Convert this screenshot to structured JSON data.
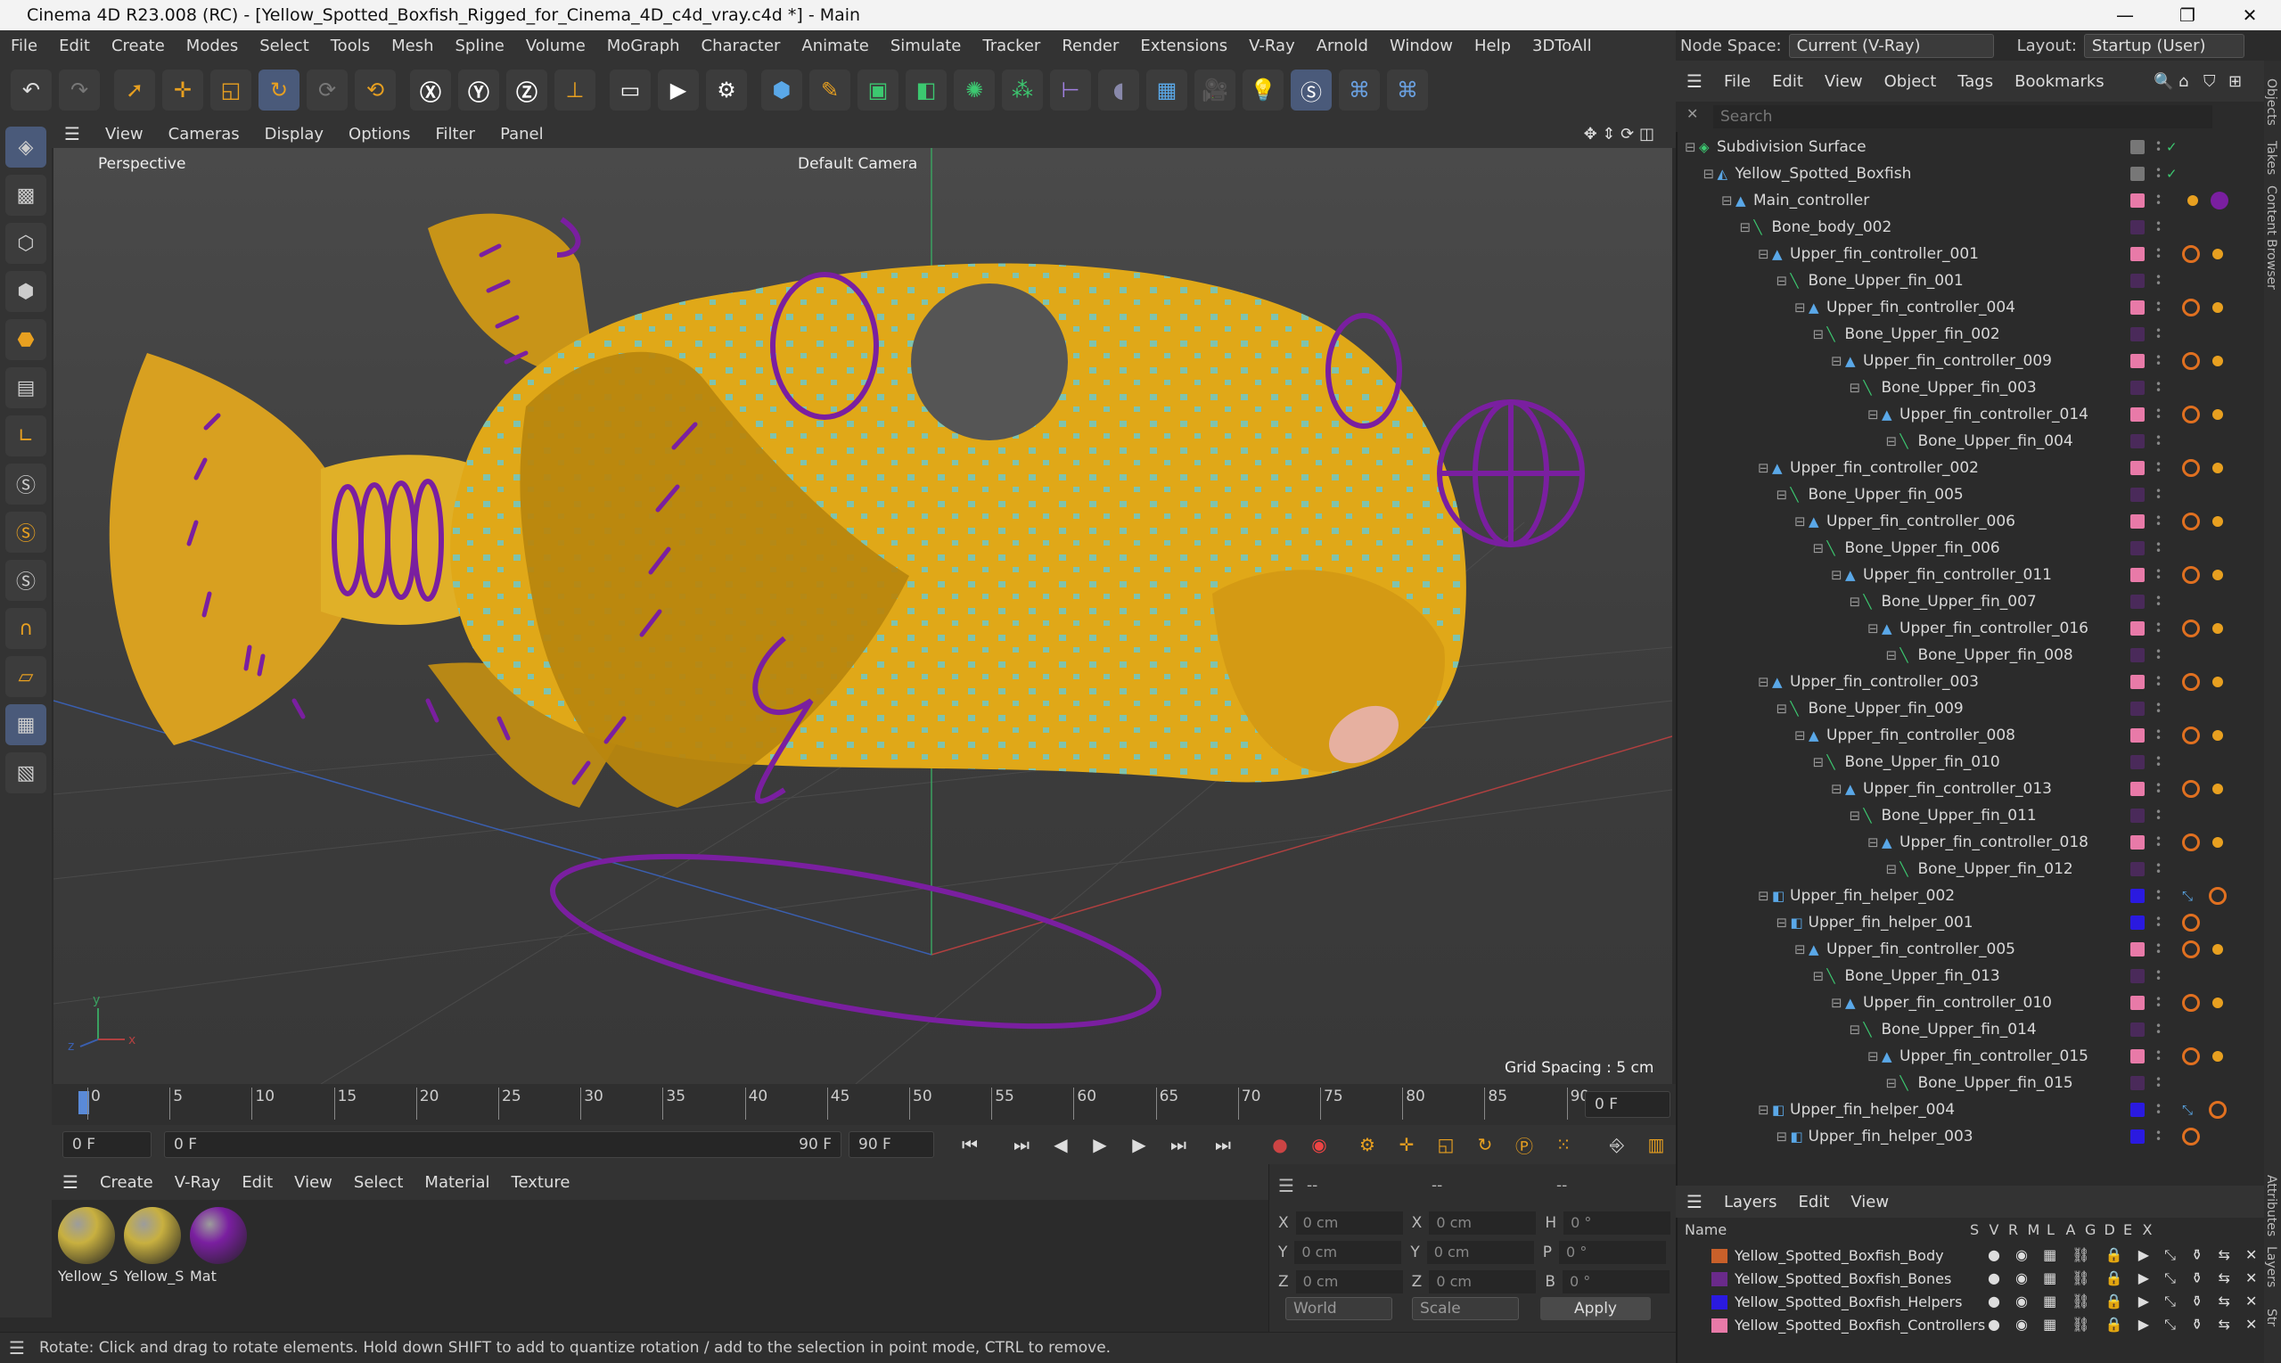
{
  "title": "Cinema 4D R23.008 (RC) - [Yellow_Spotted_Boxfish_Rigged_for_Cinema_4D_c4d_vray.c4d *] - Main",
  "menu": [
    "File",
    "Edit",
    "Create",
    "Modes",
    "Select",
    "Tools",
    "Mesh",
    "Spline",
    "Volume",
    "MoGraph",
    "Character",
    "Animate",
    "Simulate",
    "Tracker",
    "Render",
    "Extensions",
    "V-Ray",
    "Arnold",
    "Window",
    "Help",
    "3DToAll"
  ],
  "node_space": {
    "label": "Node Space:",
    "value": "Current (V-Ray)"
  },
  "layout": {
    "label": "Layout:",
    "value": "Startup (User)"
  },
  "viewport": {
    "menu": [
      "View",
      "Cameras",
      "Display",
      "Options",
      "Filter",
      "Panel"
    ],
    "mode": "Perspective",
    "camera": "Default Camera",
    "grid_spacing": "Grid Spacing : 5 cm"
  },
  "timeline": {
    "ticks": [
      "0",
      "5",
      "10",
      "15",
      "20",
      "25",
      "30",
      "35",
      "40",
      "45",
      "50",
      "55",
      "60",
      "65",
      "70",
      "75",
      "80",
      "85",
      "90"
    ],
    "current_frame": "0 F",
    "start": "0 F",
    "range_start": "0 F",
    "range_end": "90 F",
    "end": "90 F"
  },
  "material_manager": {
    "menu": [
      "Create",
      "V-Ray",
      "Edit",
      "View",
      "Select",
      "Material",
      "Texture"
    ],
    "materials": [
      {
        "label": "Yellow_S",
        "color": "#c8b040"
      },
      {
        "label": "Yellow_S",
        "color": "#c8b040"
      },
      {
        "label": "Mat",
        "color": "#7a1fa0"
      }
    ]
  },
  "coordinates": {
    "header": [
      "--",
      "--",
      "--"
    ],
    "rows": [
      {
        "a": "X",
        "av": "0 cm",
        "b": "X",
        "bv": "0 cm",
        "c": "H",
        "cv": "0 °"
      },
      {
        "a": "Y",
        "av": "0 cm",
        "b": "Y",
        "bv": "0 cm",
        "c": "P",
        "cv": "0 °"
      },
      {
        "a": "Z",
        "av": "0 cm",
        "b": "Z",
        "bv": "0 cm",
        "c": "B",
        "cv": "0 °"
      }
    ],
    "space": "World",
    "mode": "Scale",
    "apply": "Apply"
  },
  "status": "Rotate: Click and drag to rotate elements. Hold down SHIFT to add to quantize rotation / add to the selection in point mode, CTRL to remove.",
  "objects": {
    "menu": [
      "File",
      "Edit",
      "View",
      "Object",
      "Tags",
      "Bookmarks"
    ],
    "search_placeholder": "Search",
    "tree": [
      {
        "name": "Subdivision Surface",
        "depth": 0,
        "kind": "subdiv",
        "tag": "none"
      },
      {
        "name": "Yellow_Spotted_Boxfish",
        "depth": 1,
        "kind": "poly",
        "tag": "none"
      },
      {
        "name": "Main_controller",
        "depth": 2,
        "kind": "ctrl",
        "tag": "main"
      },
      {
        "name": "Bone_body_002",
        "depth": 3,
        "kind": "bone",
        "tag": "bone"
      },
      {
        "name": "Upper_fin_controller_001",
        "depth": 4,
        "kind": "ctrl",
        "tag": "ctrl"
      },
      {
        "name": "Bone_Upper_fin_001",
        "depth": 5,
        "kind": "bone",
        "tag": "bone"
      },
      {
        "name": "Upper_fin_controller_004",
        "depth": 6,
        "kind": "ctrl",
        "tag": "ctrl"
      },
      {
        "name": "Bone_Upper_fin_002",
        "depth": 7,
        "kind": "bone",
        "tag": "bone"
      },
      {
        "name": "Upper_fin_controller_009",
        "depth": 8,
        "kind": "ctrl",
        "tag": "ctrl"
      },
      {
        "name": "Bone_Upper_fin_003",
        "depth": 9,
        "kind": "bone",
        "tag": "bone"
      },
      {
        "name": "Upper_fin_controller_014",
        "depth": 10,
        "kind": "ctrl",
        "tag": "ctrl"
      },
      {
        "name": "Bone_Upper_fin_004",
        "depth": 11,
        "kind": "bone",
        "tag": "bone"
      },
      {
        "name": "Upper_fin_controller_002",
        "depth": 4,
        "kind": "ctrl",
        "tag": "ctrl"
      },
      {
        "name": "Bone_Upper_fin_005",
        "depth": 5,
        "kind": "bone",
        "tag": "bone"
      },
      {
        "name": "Upper_fin_controller_006",
        "depth": 6,
        "kind": "ctrl",
        "tag": "ctrl"
      },
      {
        "name": "Bone_Upper_fin_006",
        "depth": 7,
        "kind": "bone",
        "tag": "bone"
      },
      {
        "name": "Upper_fin_controller_011",
        "depth": 8,
        "kind": "ctrl",
        "tag": "ctrl"
      },
      {
        "name": "Bone_Upper_fin_007",
        "depth": 9,
        "kind": "bone",
        "tag": "bone"
      },
      {
        "name": "Upper_fin_controller_016",
        "depth": 10,
        "kind": "ctrl",
        "tag": "ctrl"
      },
      {
        "name": "Bone_Upper_fin_008",
        "depth": 11,
        "kind": "bone",
        "tag": "bone"
      },
      {
        "name": "Upper_fin_controller_003",
        "depth": 4,
        "kind": "ctrl",
        "tag": "ctrl"
      },
      {
        "name": "Bone_Upper_fin_009",
        "depth": 5,
        "kind": "bone",
        "tag": "bone"
      },
      {
        "name": "Upper_fin_controller_008",
        "depth": 6,
        "kind": "ctrl",
        "tag": "ctrl"
      },
      {
        "name": "Bone_Upper_fin_010",
        "depth": 7,
        "kind": "bone",
        "tag": "bone"
      },
      {
        "name": "Upper_fin_controller_013",
        "depth": 8,
        "kind": "ctrl",
        "tag": "ctrl"
      },
      {
        "name": "Bone_Upper_fin_011",
        "depth": 9,
        "kind": "bone",
        "tag": "bone"
      },
      {
        "name": "Upper_fin_controller_018",
        "depth": 10,
        "kind": "ctrl",
        "tag": "ctrl"
      },
      {
        "name": "Bone_Upper_fin_012",
        "depth": 11,
        "kind": "bone",
        "tag": "bone"
      },
      {
        "name": "Upper_fin_helper_002",
        "depth": 4,
        "kind": "helper",
        "tag": "helper"
      },
      {
        "name": "Upper_fin_helper_001",
        "depth": 5,
        "kind": "helper",
        "tag": "helper1"
      },
      {
        "name": "Upper_fin_controller_005",
        "depth": 6,
        "kind": "ctrl",
        "tag": "ctrl"
      },
      {
        "name": "Bone_Upper_fin_013",
        "depth": 7,
        "kind": "bone",
        "tag": "bone"
      },
      {
        "name": "Upper_fin_controller_010",
        "depth": 8,
        "kind": "ctrl",
        "tag": "ctrl"
      },
      {
        "name": "Bone_Upper_fin_014",
        "depth": 9,
        "kind": "bone",
        "tag": "bone"
      },
      {
        "name": "Upper_fin_controller_015",
        "depth": 10,
        "kind": "ctrl",
        "tag": "ctrl"
      },
      {
        "name": "Bone_Upper_fin_015",
        "depth": 11,
        "kind": "bone",
        "tag": "bone"
      },
      {
        "name": "Upper_fin_helper_004",
        "depth": 4,
        "kind": "helper",
        "tag": "helper"
      },
      {
        "name": "Upper_fin_helper_003",
        "depth": 5,
        "kind": "helper",
        "tag": "helper1"
      }
    ]
  },
  "layers": {
    "menu": [
      "Layers",
      "Edit",
      "View"
    ],
    "columns": [
      "Name",
      "S",
      "V",
      "R",
      "M",
      "L",
      "A",
      "G",
      "D",
      "E",
      "X"
    ],
    "items": [
      {
        "name": "Yellow_Spotted_Boxfish_Body",
        "color": "#c8602a"
      },
      {
        "name": "Yellow_Spotted_Boxfish_Bones",
        "color": "#6a2a8a"
      },
      {
        "name": "Yellow_Spotted_Boxfish_Helpers",
        "color": "#2a1ae0"
      },
      {
        "name": "Yellow_Spotted_Boxfish_Controllers",
        "color": "#e87aa8"
      }
    ]
  },
  "side_tabs": [
    "Objects",
    "Takes",
    "Content Browser",
    "Attributes",
    "Layers",
    "Str"
  ],
  "colors": {
    "accent": "#4a5a7a",
    "fish": "#e0a818",
    "spots": "#6ec8c8",
    "rig": "#7a1fa0"
  }
}
